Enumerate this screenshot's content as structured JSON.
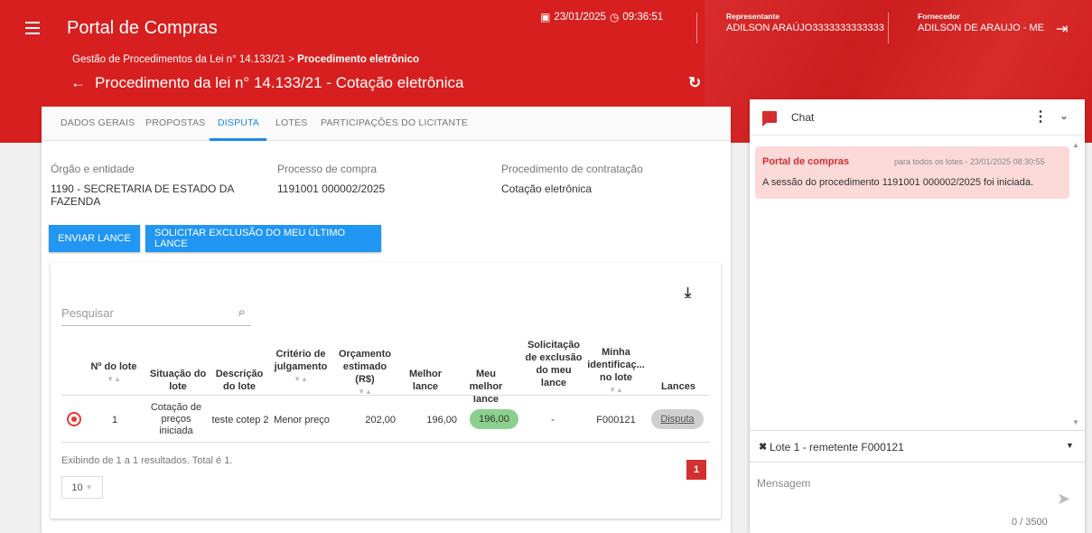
{
  "header": {
    "app_title": "Portal de Compras",
    "date": "23/01/2025",
    "time": "09:36:51",
    "representante_label": "Representante",
    "representante_value": "ADILSON ARAÚJO3333333333333",
    "fornecedor_label": "Fornecedor",
    "fornecedor_value": "ADILSON DE ARAUJO - ME",
    "breadcrumb_prefix": "Gestão de Procedimentos da Lei n° 14.133/21 > ",
    "breadcrumb_current": "Procedimento eletrônico",
    "page_title": "Procedimento da lei n° 14.133/21 - Cotação eletrônica"
  },
  "tabs": [
    "DADOS GERAIS",
    "PROPOSTAS",
    "DISPUTA",
    "LOTES",
    "PARTICIPAÇÕES DO LICITANTE"
  ],
  "active_tab": "DISPUTA",
  "info": {
    "orgao_label": "Órgão e entidade",
    "orgao_value": "1190 - SECRETARIA DE ESTADO DA FAZENDA",
    "processo_label": "Processo de compra",
    "processo_value": "1191001 000002/2025",
    "procedimento_label": "Procedimento de contratação",
    "procedimento_value": "Cotação eletrônica"
  },
  "actions": {
    "enviar_lance": "ENVIAR LANCE",
    "solicitar_exclusao": "SOLICITAR EXCLUSÃO DO MEU ÚLTIMO LANCE"
  },
  "table": {
    "search_placeholder": "Pesquisar",
    "columns": {
      "lote": "Nº do lote",
      "situacao": "Situação do lote",
      "descricao": "Descrição do lote",
      "criterio": "Critério de julgamento",
      "orcamento": "Orçamento estimado (R$)",
      "melhor": "Melhor lance",
      "meu_melhor": "Meu melhor lance",
      "solicitacao": "Solicitação de exclusão do meu lance",
      "identificacao": "Minha identificaç... no lote",
      "lances": "Lances"
    },
    "rows": [
      {
        "lote": "1",
        "situacao": "Cotação de preços iniciada",
        "descricao": "teste cotep 2",
        "criterio": "Menor preço",
        "orcamento": "202,00",
        "melhor": "196,00",
        "meu_melhor": "196,00",
        "solicitacao": "-",
        "identificacao": "F000121",
        "lances": "Disputa"
      }
    ],
    "footer": "Exibindo de 1 a 1 resultados. Total é 1.",
    "page_size": "10",
    "current_page": "1"
  },
  "chat": {
    "title": "Chat",
    "message": {
      "from": "Portal de compras",
      "meta": "para todos os lotes  -  23/01/2025 08:30:55",
      "text": "A sessão do procedimento 1191001 000002/2025 foi iniciada."
    },
    "lote_selector": "Lote 1 - remetente F000121",
    "input_placeholder": "Mensagem",
    "counter": "0 / 3500"
  },
  "colors": {
    "brand_red": "#d71f1f",
    "primary_blue": "#2196f3",
    "success_green": "#8bd08d"
  }
}
